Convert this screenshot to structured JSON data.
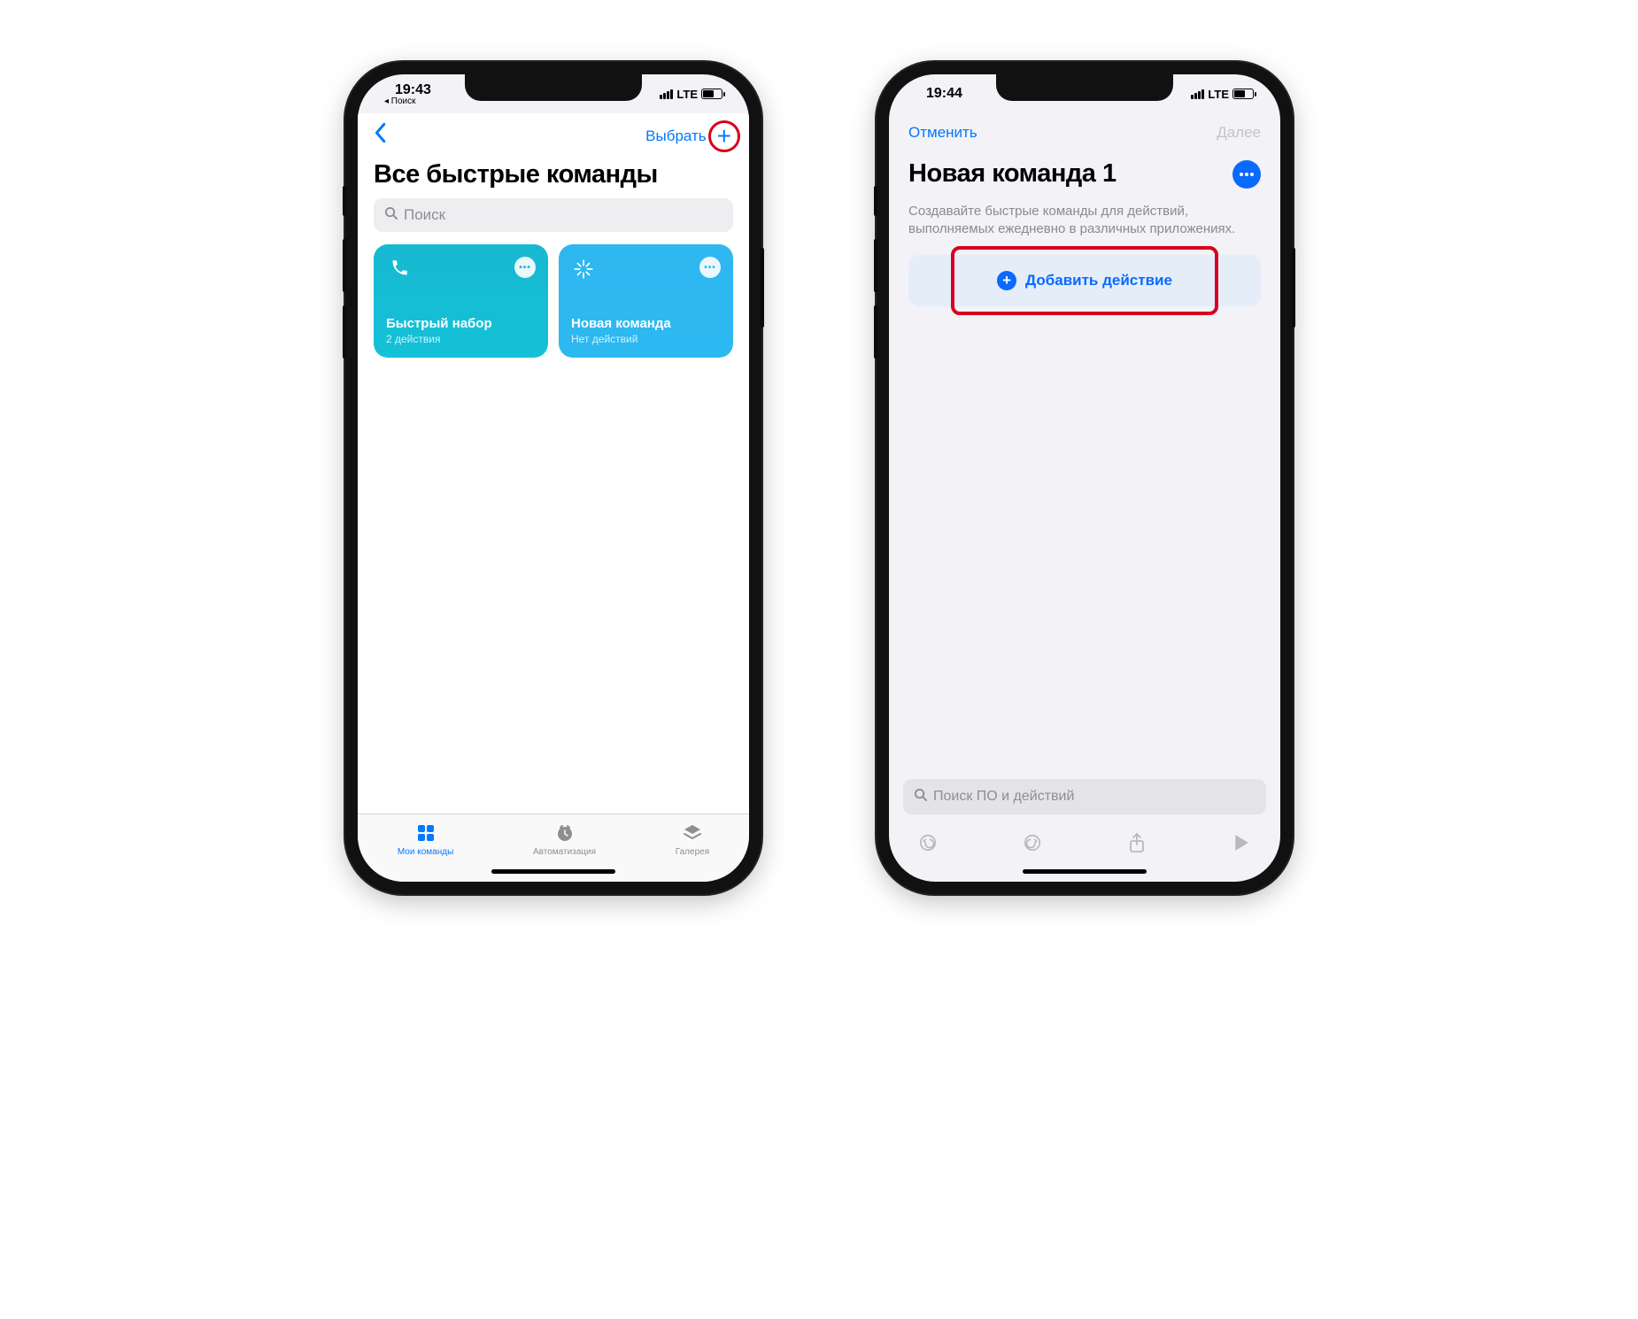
{
  "phone1": {
    "status": {
      "time": "19:43",
      "back_app": "◂ Поиск",
      "network": "LTE"
    },
    "nav": {
      "select": "Выбрать"
    },
    "title": "Все быстрые команды",
    "search_placeholder": "Поиск",
    "tiles": [
      {
        "title": "Быстрый набор",
        "subtitle": "2 действия",
        "icon": "phone"
      },
      {
        "title": "Новая команда",
        "subtitle": "Нет действий",
        "icon": "wand"
      }
    ],
    "tabs": [
      {
        "label": "Мои команды",
        "active": true
      },
      {
        "label": "Автоматизация",
        "active": false
      },
      {
        "label": "Галерея",
        "active": false
      }
    ]
  },
  "phone2": {
    "status": {
      "time": "19:44",
      "network": "LTE"
    },
    "nav": {
      "cancel": "Отменить",
      "next": "Далее"
    },
    "title": "Новая команда 1",
    "description": "Создавайте быстрые команды для действий, выполняемых ежедневно в различных приложениях.",
    "add_action": "Добавить действие",
    "search_placeholder": "Поиск ПО и действий"
  }
}
